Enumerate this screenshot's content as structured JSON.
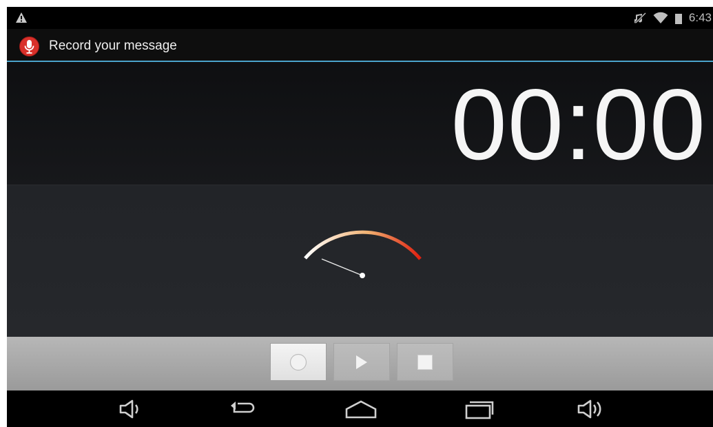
{
  "status_bar": {
    "time": "6:43",
    "icons": [
      "warning-icon",
      "mute-icon",
      "wifi-icon",
      "battery-icon"
    ]
  },
  "action_bar": {
    "title": "Record your message",
    "icon": "microphone-icon",
    "accent_color": "#4aa4cc"
  },
  "timer": {
    "value": "00:00"
  },
  "level_meter": {
    "level": 0,
    "gradient_colors": [
      "#ffffff",
      "#f0b070",
      "#e02010"
    ]
  },
  "controls": {
    "buttons": [
      {
        "name": "record",
        "icon": "record-icon",
        "state": "active"
      },
      {
        "name": "play",
        "icon": "play-icon",
        "state": "disabled"
      },
      {
        "name": "stop",
        "icon": "stop-icon",
        "state": "disabled"
      }
    ]
  },
  "navigation": {
    "buttons": [
      "volume-down-icon",
      "back-icon",
      "home-icon",
      "recent-apps-icon",
      "volume-up-icon"
    ]
  }
}
